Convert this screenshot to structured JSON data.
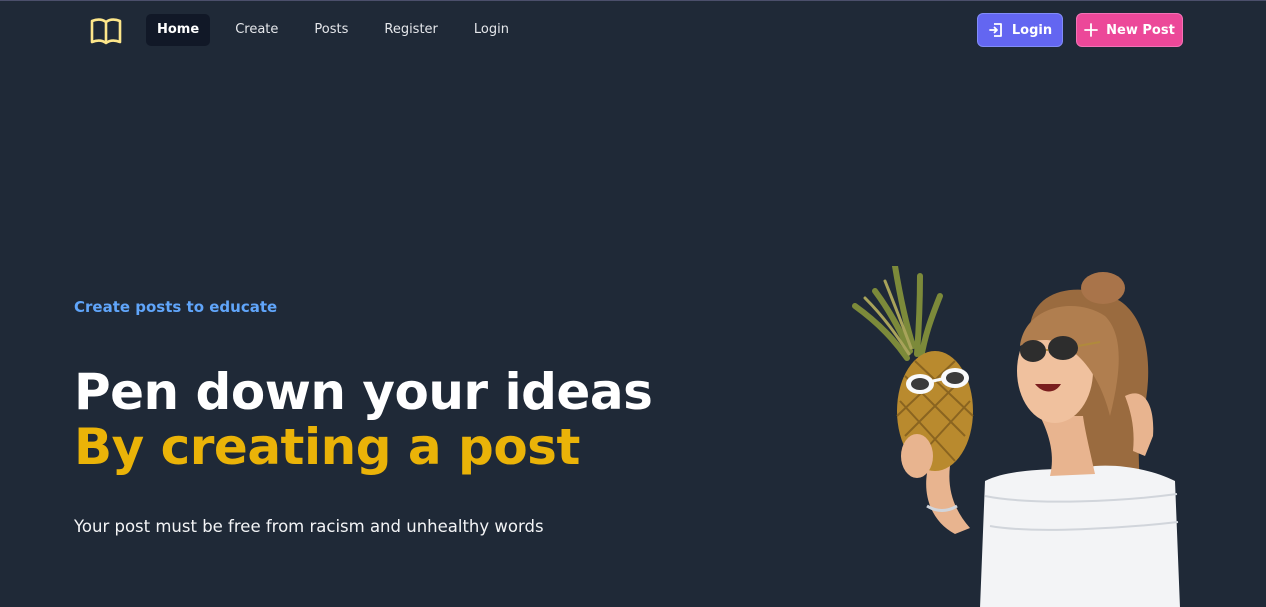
{
  "nav": {
    "links": [
      {
        "label": "Home"
      },
      {
        "label": "Create"
      },
      {
        "label": "Posts"
      },
      {
        "label": "Register"
      },
      {
        "label": "Login"
      }
    ],
    "login_button": "Login",
    "new_post_button": "New Post"
  },
  "hero": {
    "eyebrow": "Create posts to educate",
    "headline_line1": "Pen down your ideas",
    "headline_line2": "By creating a post",
    "subtext": "Your post must be free from racism and unhealthy words"
  },
  "colors": {
    "background": "#1f2937",
    "accent_yellow": "#eab308",
    "accent_blue": "#60a5fa",
    "login_button": "#6366f1",
    "new_post_button": "#ec4899"
  },
  "icons": {
    "logo": "open-book-icon",
    "login": "login-arrow-icon",
    "new_post": "plus-icon"
  }
}
